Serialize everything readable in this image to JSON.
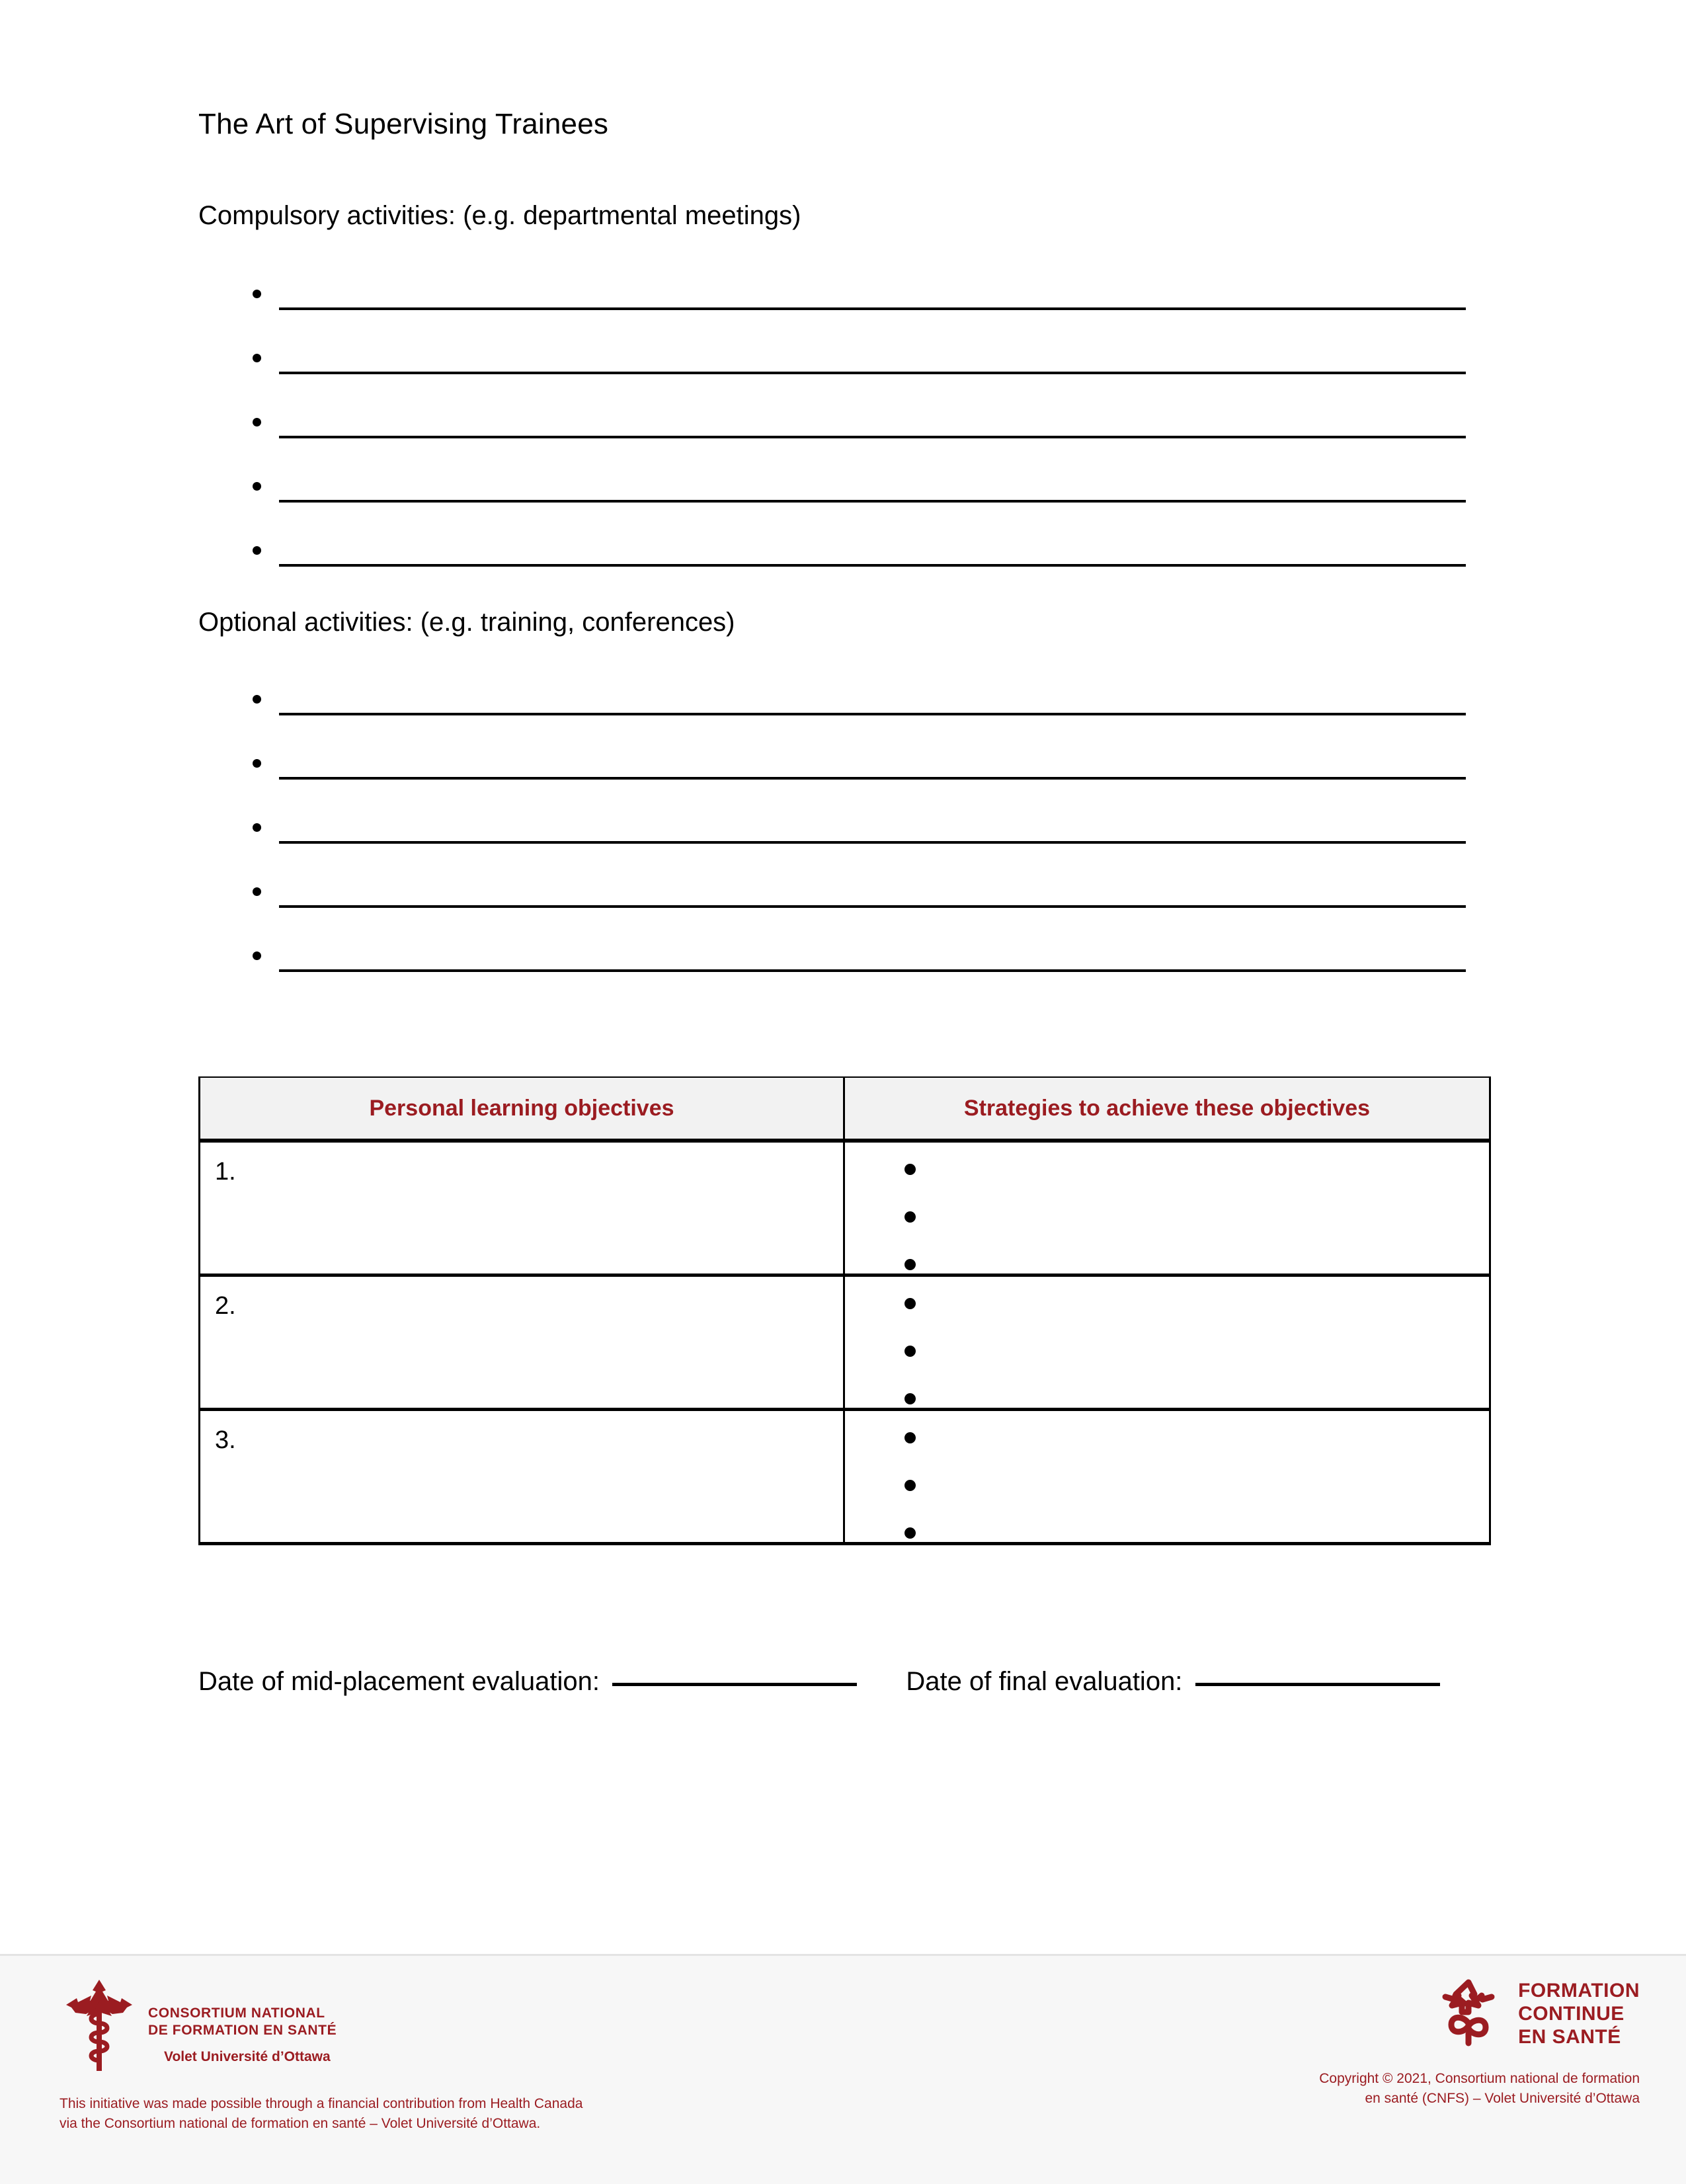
{
  "document": {
    "title": "The Art of Supervising Trainees"
  },
  "sections": {
    "compulsory": {
      "label": "Compulsory activities: (e.g. departmental meetings)",
      "blank_lines": 5
    },
    "optional": {
      "label": "Optional activities: (e.g. training, conferences)",
      "blank_lines": 5
    }
  },
  "table": {
    "headers": [
      "Personal learning objectives",
      "Strategies to achieve these objectives"
    ],
    "header_text_color": "#9b1c21",
    "header_bg_color": "#f2f2f2",
    "rows": [
      {
        "number": "1.",
        "strategy_bullets": 3
      },
      {
        "number": "2.",
        "strategy_bullets": 3
      },
      {
        "number": "3.",
        "strategy_bullets": 3
      }
    ]
  },
  "evaluation": {
    "mid_label": "Date of mid-placement evaluation:",
    "final_label": "Date of final evaluation:",
    "mid_value": "",
    "final_value": ""
  },
  "footer": {
    "brand_color": "#9b1c21",
    "cnfs": {
      "line1": "CONSORTIUM NATIONAL",
      "line2": "DE FORMATION EN SANTÉ",
      "volet": "Volet Université d’Ottawa",
      "note_line1": "This initiative was made possible through a financial contribution from Health Canada",
      "note_line2": "via the Consortium national de formation en santé – Volet Université d’Ottawa."
    },
    "fcs": {
      "line1": "FORMATION",
      "line2": "CONTINUE",
      "line3": "EN SANTÉ",
      "copyright_line1": "Copyright © 2021, Consortium national de formation",
      "copyright_line2": "en santé (CNFS) – Volet Université d’Ottawa"
    }
  }
}
